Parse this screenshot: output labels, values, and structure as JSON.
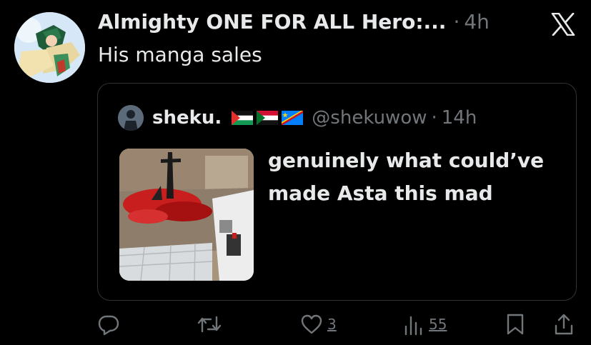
{
  "tweet": {
    "author_name": "Almighty ONE FOR ALL Hero:...",
    "separator": "·",
    "time": "4h",
    "text": "His manga sales"
  },
  "quote": {
    "name": "sheku.",
    "flags": [
      "palestine-flag",
      "sudan-flag",
      "dr-congo-flag"
    ],
    "handle": "@shekuwow",
    "separator": "·",
    "time": "14h",
    "text_line1": "genuinely what could’ve",
    "text_line2": "made Asta this mad"
  },
  "actions": {
    "likes": "3",
    "views": "55"
  },
  "colors": {
    "background": "#000000",
    "text": "#e7e9ea",
    "muted": "#71767b",
    "border": "#2f3336"
  },
  "icons": [
    "x-logo-icon",
    "reply-icon",
    "retweet-icon",
    "heart-icon",
    "views-icon",
    "bookmark-icon",
    "share-icon"
  ]
}
